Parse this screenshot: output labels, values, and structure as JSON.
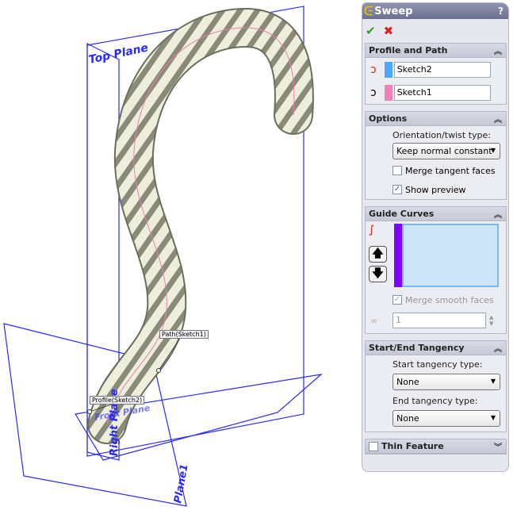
{
  "viewport": {
    "labels": {
      "top_plane": "Top Plane",
      "right_plane": "Right Plane",
      "front_plane": "Front Plane",
      "plane1": "Plane1",
      "path_callout": "Path(Sketch1)",
      "profile_callout": "Profile(Sketch2)"
    },
    "plane_color": "#2a2aff"
  },
  "panel": {
    "title": "Sweep",
    "help": "?",
    "ok_icon": "check-icon",
    "cancel_icon": "x-icon",
    "profile_path": {
      "header": "Profile and Path",
      "profile": {
        "value": "Sketch2",
        "color": "#4da6ff"
      },
      "path": {
        "value": "Sketch1",
        "color": "#f27fb8"
      }
    },
    "options": {
      "header": "Options",
      "orientation_label": "Orientation/twist type:",
      "orientation_value": "Keep normal constant",
      "merge_tangent": {
        "label": "Merge tangent faces",
        "checked": false
      },
      "show_preview": {
        "label": "Show preview",
        "checked": true
      }
    },
    "guide_curves": {
      "header": "Guide Curves",
      "list_color": "#7f00ff",
      "merge_smooth": {
        "label": "Merge smooth faces",
        "checked": true,
        "disabled": true
      },
      "count_value": "1"
    },
    "tangency": {
      "header": "Start/End Tangency",
      "start_label": "Start tangency type:",
      "start_value": "None",
      "end_label": "End tangency type:",
      "end_value": "None"
    },
    "thin_feature": {
      "label": "Thin Feature",
      "checked": false
    }
  }
}
